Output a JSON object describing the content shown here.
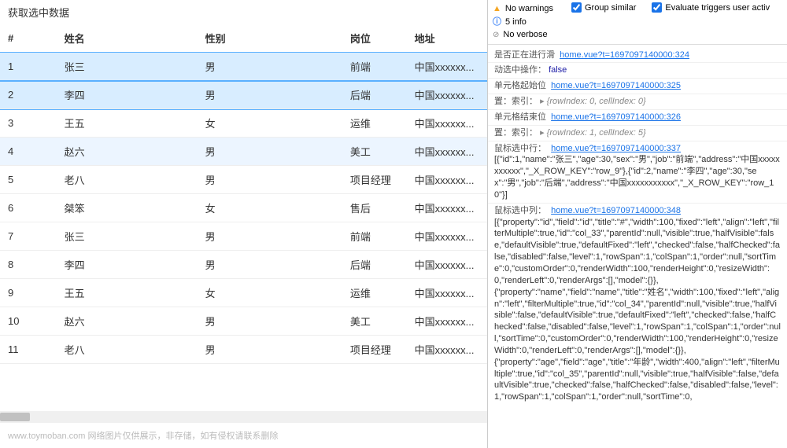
{
  "panel_title": "获取选中数据",
  "columns": [
    {
      "key": "id",
      "label": "#"
    },
    {
      "key": "name",
      "label": "姓名"
    },
    {
      "key": "sex",
      "label": "性别"
    },
    {
      "key": "job",
      "label": "岗位"
    },
    {
      "key": "addr",
      "label": "地址"
    }
  ],
  "rows": [
    {
      "id": "1",
      "name": "张三",
      "sex": "男",
      "job": "前端",
      "addr": "中国xxxxxx...",
      "state": "sel"
    },
    {
      "id": "2",
      "name": "李四",
      "sex": "男",
      "job": "后端",
      "addr": "中国xxxxxx...",
      "state": "sel"
    },
    {
      "id": "3",
      "name": "王五",
      "sex": "女",
      "job": "运维",
      "addr": "中国xxxxxx...",
      "state": ""
    },
    {
      "id": "4",
      "name": "赵六",
      "sex": "男",
      "job": "美工",
      "addr": "中国xxxxxx...",
      "state": "hover-row"
    },
    {
      "id": "5",
      "name": "老八",
      "sex": "男",
      "job": "项目经理",
      "addr": "中国xxxxxx...",
      "state": ""
    },
    {
      "id": "6",
      "name": "桀笨",
      "sex": "女",
      "job": "售后",
      "addr": "中国xxxxxx...",
      "state": ""
    },
    {
      "id": "7",
      "name": "张三",
      "sex": "男",
      "job": "前端",
      "addr": "中国xxxxxx...",
      "state": ""
    },
    {
      "id": "8",
      "name": "李四",
      "sex": "男",
      "job": "后端",
      "addr": "中国xxxxxx...",
      "state": ""
    },
    {
      "id": "9",
      "name": "王五",
      "sex": "女",
      "job": "运维",
      "addr": "中国xxxxxx...",
      "state": ""
    },
    {
      "id": "10",
      "name": "赵六",
      "sex": "男",
      "job": "美工",
      "addr": "中国xxxxxx...",
      "state": ""
    },
    {
      "id": "11",
      "name": "老八",
      "sex": "男",
      "job": "项目经理",
      "addr": "中国xxxxxx...",
      "state": ""
    }
  ],
  "footer": "www.toymoban.com 网络图片仅供展示，非存储，如有侵权请联系删除",
  "filters": {
    "no_warnings": "No warnings",
    "info": "5 info",
    "no_verbose": "No verbose",
    "group_similar": "Group similar",
    "evaluate_triggers": "Evaluate triggers user activ"
  },
  "console": {
    "l1": {
      "label": "是否正在进行滑",
      "src": "home.vue?t=1697097140000:324"
    },
    "l2": {
      "label": "动选中操作：",
      "val": "false"
    },
    "l3": {
      "label": "单元格起始位",
      "src": "home.vue?t=1697097140000:325"
    },
    "l4": {
      "label": "置：索引：",
      "obj": "{rowIndex: 0, cellIndex: 0}"
    },
    "l5": {
      "label": "单元格结束位",
      "src": "home.vue?t=1697097140000:326"
    },
    "l6": {
      "label": "置：索引：",
      "obj": "{rowIndex: 1, cellIndex: 5}"
    },
    "l7": {
      "label": "鼠标选中行：",
      "src": "home.vue?t=1697097140000:337"
    },
    "l8": "[{\"id\":1,\"name\":\"张三\",\"age\":30,\"sex\":\"男\",\"job\":\"前端\",\"address\":\"中国xxxxxxxxxxx\",\"_X_ROW_KEY\":\"row_9\"},{\"id\":2,\"name\":\"李四\",\"age\":30,\"sex\":\"男\",\"job\":\"后端\",\"address\":\"中国xxxxxxxxxxx\",\"_X_ROW_KEY\":\"row_10\"}]",
    "l9": {
      "label": "鼠标选中列：",
      "src": "home.vue?t=1697097140000:348"
    },
    "l10": "[{\"property\":\"id\",\"field\":\"id\",\"title\":\"#\",\"width\":100,\"fixed\":\"left\",\"align\":\"left\",\"filterMultiple\":true,\"id\":\"col_33\",\"parentId\":null,\"visible\":true,\"halfVisible\":false,\"defaultVisible\":true,\"defaultFixed\":\"left\",\"checked\":false,\"halfChecked\":false,\"disabled\":false,\"level\":1,\"rowSpan\":1,\"colSpan\":1,\"order\":null,\"sortTime\":0,\"customOrder\":0,\"renderWidth\":100,\"renderHeight\":0,\"resizeWidth\":0,\"renderLeft\":0,\"renderArgs\":[],\"model\":{}},",
    "l11": "{\"property\":\"name\",\"field\":\"name\",\"title\":\"姓名\",\"width\":100,\"fixed\":\"left\",\"align\":\"left\",\"filterMultiple\":true,\"id\":\"col_34\",\"parentId\":null,\"visible\":true,\"halfVisible\":false,\"defaultVisible\":true,\"defaultFixed\":\"left\",\"checked\":false,\"halfChecked\":false,\"disabled\":false,\"level\":1,\"rowSpan\":1,\"colSpan\":1,\"order\":null,\"sortTime\":0,\"customOrder\":0,\"renderWidth\":100,\"renderHeight\":0,\"resizeWidth\":0,\"renderLeft\":0,\"renderArgs\":[],\"model\":{}},",
    "l12": "{\"property\":\"age\",\"field\":\"age\",\"title\":\"年龄\",\"width\":400,\"align\":\"left\",\"filterMultiple\":true,\"id\":\"col_35\",\"parentId\":null,\"visible\":true,\"halfVisible\":false,\"defaultVisible\":true,\"checked\":false,\"halfChecked\":false,\"disabled\":false,\"level\":1,\"rowSpan\":1,\"colSpan\":1,\"order\":null,\"sortTime\":0,"
  }
}
